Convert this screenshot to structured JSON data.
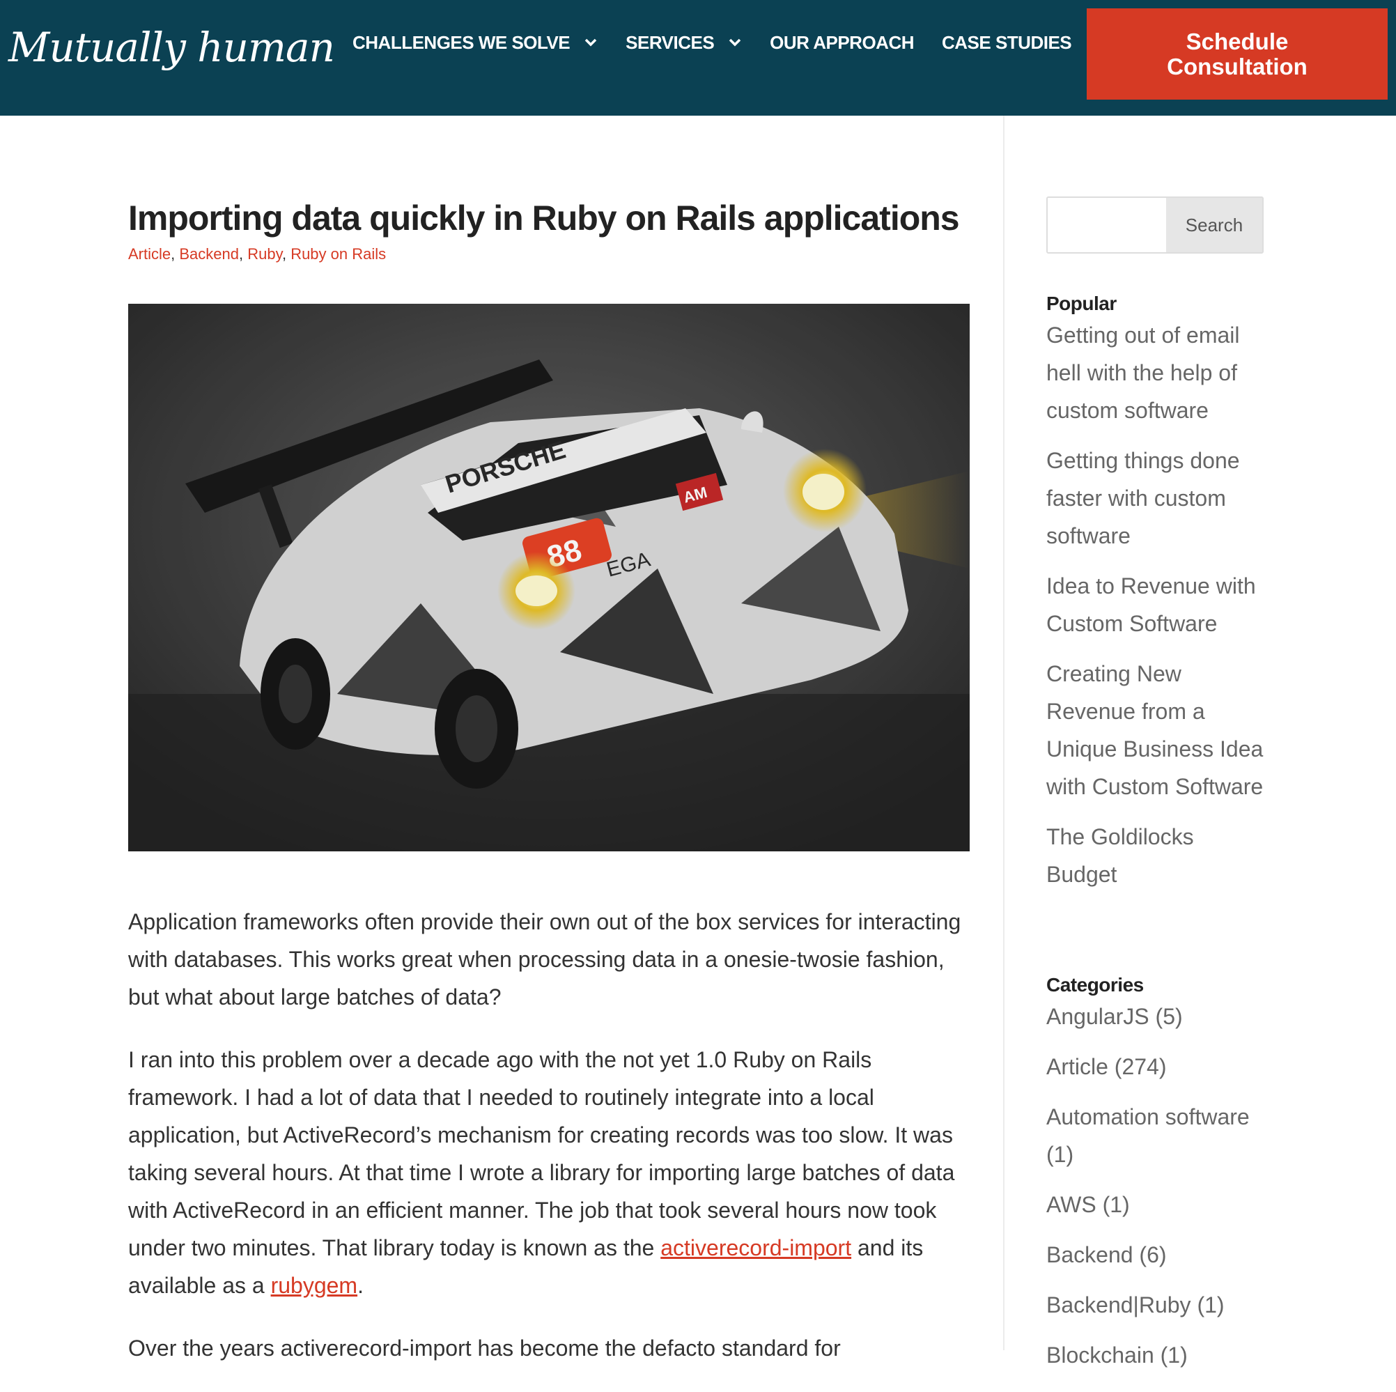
{
  "header": {
    "logo_text": "Mutually human",
    "nav": [
      {
        "label": "CHALLENGES WE SOLVE",
        "dropdown": true
      },
      {
        "label": "SERVICES",
        "dropdown": true
      },
      {
        "label": "OUR APPROACH",
        "dropdown": false
      },
      {
        "label": "CASE STUDIES",
        "dropdown": false
      }
    ],
    "more_label": "···",
    "cta_line1": "Schedule",
    "cta_line2": "Consultation",
    "colors": {
      "bar": "#0b4153",
      "cta": "#d63a24"
    }
  },
  "article": {
    "title": "Importing data quickly in Ruby on Rails applications",
    "categories": [
      "Article",
      "Backend",
      "Ruby",
      "Ruby on Rails"
    ],
    "hero_image": "Porsche race car number 88 driving in the rain with headlights on",
    "car_text": {
      "brand": "PORSCHE",
      "number": "88",
      "decal": "EGA",
      "badge": "AM"
    },
    "para1": "Application frameworks often provide their own out of the box services for interacting with databases. This works great when processing data in a onesie-twosie fashion, but what about large batches of data?",
    "para2_text": "I ran into this problem over a decade ago with the not yet 1.0 Ruby on Rails framework. I had a lot of data that I needed to routinely integrate into a local application, but ActiveRecord’s mechanism for creating records was too slow. It was taking several hours. At that time I wrote a library for importing large batches of data with ActiveRecord in an efficient manner. The job that took several hours now took under two minutes. That library today is known as the ",
    "para2_link1": "activerecord-import",
    "para2_mid": " and its available as a ",
    "para2_link2": "rubygem",
    "para2_end": ".",
    "para3": "Over the years activerecord-import has become the defacto standard for"
  },
  "sidebar": {
    "search_placeholder": "",
    "search_button": "Search",
    "popular_heading": "Popular",
    "popular": [
      "Getting out of email hell with the help of custom software",
      "Getting things done faster with custom software",
      "Idea to Revenue with Custom Software",
      "Creating New Revenue from a Unique Business Idea with Custom Software",
      "The Goldilocks Budget"
    ],
    "categories_heading": "Categories",
    "categories": [
      "AngularJS (5)",
      "Article (274)",
      "Automation software (1)",
      "AWS (1)",
      "Backend (6)",
      "Backend|Ruby (1)",
      "Blockchain (1)"
    ]
  }
}
